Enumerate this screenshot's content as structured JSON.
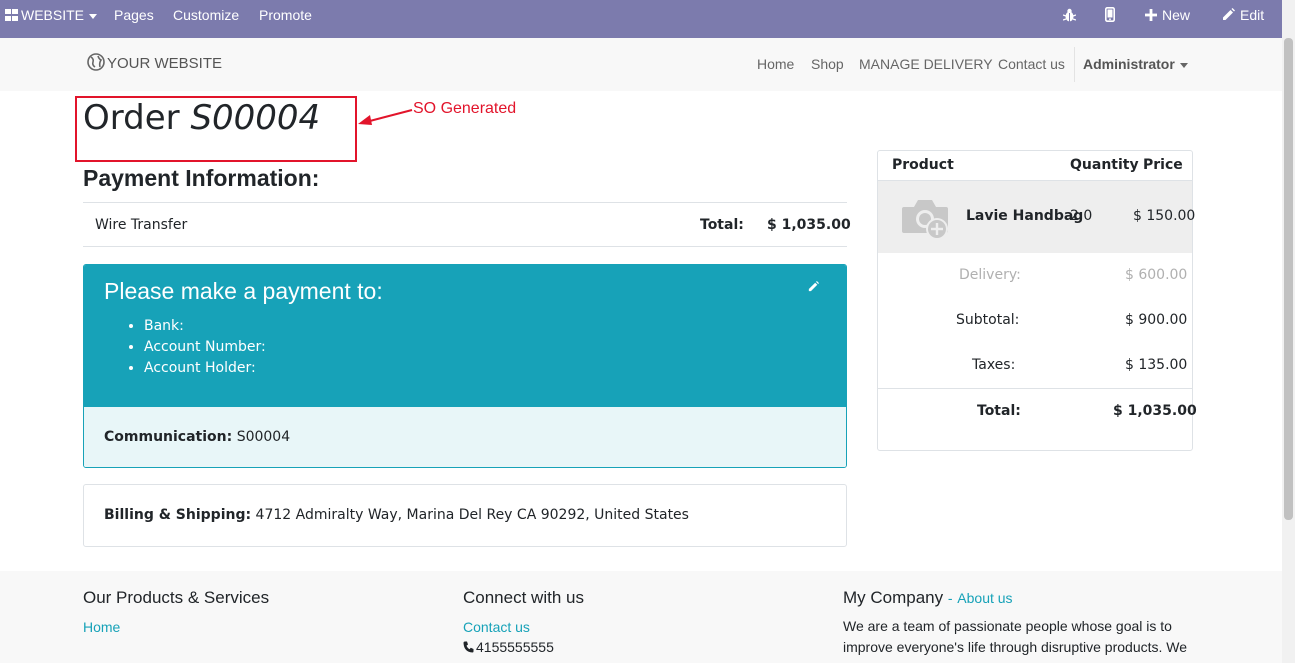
{
  "admin_bar": {
    "website_label": "WEBSITE",
    "pages": "Pages",
    "customize": "Customize",
    "promote": "Promote",
    "new": "New",
    "edit": "Edit"
  },
  "nav": {
    "logo": "YOUR WEBSITE",
    "home": "Home",
    "shop": "Shop",
    "manage_delivery": "MANAGE DELIVERY",
    "contact": "Contact us",
    "user": "Administrator"
  },
  "order": {
    "prefix": "Order",
    "number": "S00004",
    "annotation": "SO Generated"
  },
  "payment_info": {
    "title": "Payment Information:",
    "method": "Wire Transfer",
    "total_label": "Total:",
    "total_value": "$ 1,035.00"
  },
  "payment_panel": {
    "heading": "Please make a payment to:",
    "bank": "Bank:",
    "account_number": "Account Number:",
    "account_holder": "Account Holder:",
    "communication_label": "Communication:",
    "communication_value": "S00004"
  },
  "billing": {
    "label": "Billing & Shipping:",
    "address": "4712 Admiralty Way, Marina Del Rey CA 90292, United States"
  },
  "summary": {
    "col_product": "Product",
    "col_quantity": "Quantity",
    "col_price": "Price",
    "product_name": "Lavie Handbag",
    "product_qty": "2.0",
    "product_price": "$ 150.00",
    "delivery_label": "Delivery:",
    "delivery_value": "$ 600.00",
    "subtotal_label": "Subtotal:",
    "subtotal_value": "$ 900.00",
    "taxes_label": "Taxes:",
    "taxes_value": "$ 135.00",
    "total_label": "Total:",
    "total_value": "$ 1,035.00"
  },
  "footer": {
    "col1_title": "Our Products & Services",
    "col1_link": "Home",
    "col2_title": "Connect with us",
    "col2_link": "Contact us",
    "col2_phone": "4155555555",
    "col3_title": "My Company",
    "col3_dash": "-",
    "col3_link": "About us",
    "col3_text": "We are a team of passionate people whose goal is to improve everyone's life through disruptive products. We"
  },
  "colors": {
    "admin_bar": "#7c7bad",
    "teal": "#17a2b8",
    "annotation": "#e2142b"
  }
}
